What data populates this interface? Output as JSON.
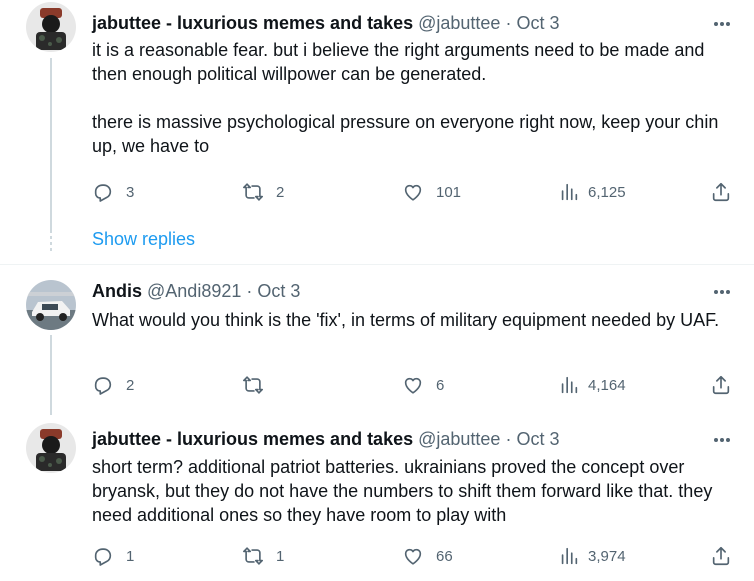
{
  "tweets": [
    {
      "name": "jabuttee - luxurious memes and takes",
      "handle": "@jabuttee",
      "sep": "·",
      "date": "Oct 3",
      "text": "it is a reasonable fear. but i believe the right arguments need to be made and then enough political willpower can be generated.\n\nthere is massive psychological pressure on everyone right now, keep your chin up, we have to",
      "replies": "3",
      "retweets": "2",
      "likes": "101",
      "views": "6,125"
    },
    {
      "name": "Andis",
      "handle": "@Andi8921",
      "sep": "·",
      "date": "Oct 3",
      "text": "What would you think is the 'fix', in terms of military equipment needed by UAF.",
      "replies": "2",
      "retweets": "",
      "likes": "6",
      "views": "4,164"
    },
    {
      "name": "jabuttee - luxurious memes and takes",
      "handle": "@jabuttee",
      "sep": "·",
      "date": "Oct 3",
      "text": "short term? additional patriot batteries. ukrainians proved the concept over bryansk, but they do not have the numbers to shift them forward like that. they need additional ones so they have room to play with",
      "replies": "1",
      "retweets": "1",
      "likes": "66",
      "views": "3,974"
    }
  ],
  "show_replies": "Show replies",
  "icons": {
    "reply": "reply-icon",
    "retweet": "retweet-icon",
    "like": "heart-icon",
    "views": "views-chart-icon",
    "share": "share-icon",
    "more": "more-options-icon"
  },
  "colors": {
    "link": "#1d9bf0",
    "secondary": "#536471",
    "thread_line": "#cfd9de"
  }
}
